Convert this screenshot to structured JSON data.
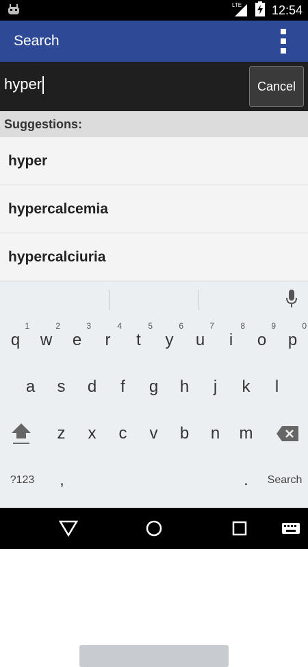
{
  "status": {
    "time": "12:54",
    "network": "LTE"
  },
  "appbar": {
    "title": "Search"
  },
  "search": {
    "value": "hyper",
    "cancel_label": "Cancel"
  },
  "suggestions": {
    "header": "Suggestions:",
    "items": [
      "hyper",
      "hypercalcemia",
      "hypercalciuria"
    ]
  },
  "keyboard": {
    "row1": [
      {
        "k": "q",
        "n": "1"
      },
      {
        "k": "w",
        "n": "2"
      },
      {
        "k": "e",
        "n": "3"
      },
      {
        "k": "r",
        "n": "4"
      },
      {
        "k": "t",
        "n": "5"
      },
      {
        "k": "y",
        "n": "6"
      },
      {
        "k": "u",
        "n": "7"
      },
      {
        "k": "i",
        "n": "8"
      },
      {
        "k": "o",
        "n": "9"
      },
      {
        "k": "p",
        "n": "0"
      }
    ],
    "row2": [
      "a",
      "s",
      "d",
      "f",
      "g",
      "h",
      "j",
      "k",
      "l"
    ],
    "row3": [
      "z",
      "x",
      "c",
      "v",
      "b",
      "n",
      "m"
    ],
    "bottom": {
      "symbols": "?123",
      "comma": ",",
      "period": ".",
      "action": "Search"
    }
  },
  "colors": {
    "appbar": "#2E4A96",
    "searchbar": "#1f1f1f"
  }
}
